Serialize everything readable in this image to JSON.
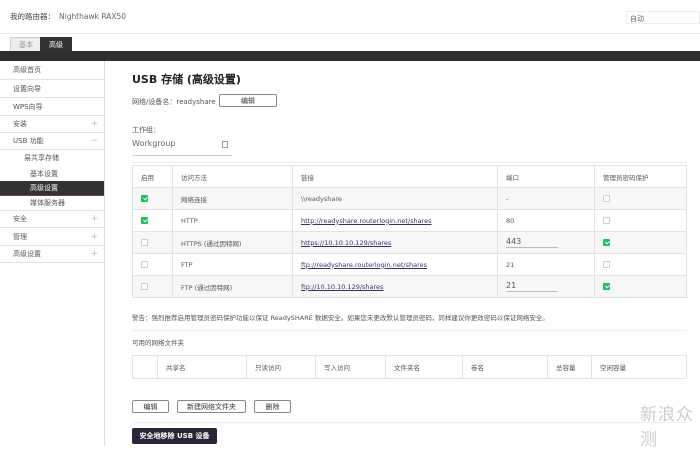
{
  "header": {
    "router_label": "我的路由器：",
    "router_name": "Nighthawk RAX50",
    "language": "自动"
  },
  "tabs": [
    {
      "label": "基本"
    },
    {
      "label": "高级"
    }
  ],
  "sidebar": {
    "items": [
      {
        "label": "高级首页"
      },
      {
        "label": "设置向导"
      },
      {
        "label": "WPS向导"
      },
      {
        "label": "安装",
        "toggle": "+"
      },
      {
        "label": "USB 功能",
        "toggle": "−"
      },
      {
        "label": "易共享存储"
      },
      {
        "label": "基本设置"
      },
      {
        "label": "高级设置"
      },
      {
        "label": "媒体服务器"
      },
      {
        "label": "安全",
        "toggle": "+"
      },
      {
        "label": "管理",
        "toggle": "+"
      },
      {
        "label": "高级设置",
        "toggle": "+"
      }
    ]
  },
  "main": {
    "title": "USB 存储 (高级设置)",
    "device_label": "网络/设备名：",
    "device_name": "readyshare",
    "edit_label": "编辑",
    "workgroup_label": "工作组：",
    "workgroup_value": "Workgroup",
    "protocol_table": {
      "headers": [
        "启用",
        "访问方法",
        "链接",
        "端口",
        "管理员密码保护"
      ],
      "rows": [
        {
          "enabled": true,
          "method": "网络连接",
          "link": "\\\\readyshare",
          "is_link": false,
          "port": "-",
          "port_editable": false,
          "protected": false
        },
        {
          "enabled": true,
          "method": "HTTP",
          "link": "http://readyshare.routerlogin.net/shares",
          "is_link": true,
          "port": "80",
          "port_editable": false,
          "protected": false
        },
        {
          "enabled": false,
          "method": "HTTPS (通过因特网)",
          "link": "https://10.10.10.129/shares",
          "is_link": true,
          "port": "443",
          "port_editable": true,
          "protected": true
        },
        {
          "enabled": false,
          "method": "FTP",
          "link": "ftp://readyshare.routerlogin.net/shares",
          "is_link": true,
          "port": "21",
          "port_editable": false,
          "protected": false
        },
        {
          "enabled": false,
          "method": "FTP (通过因特网)",
          "link": "ftp://10.10.10.129/shares",
          "is_link": true,
          "port": "21",
          "port_editable": true,
          "protected": true
        }
      ]
    },
    "warning": "警告：强烈推荐启用管理员密码保护功能以保证 ReadySHARE 数据安全。如果您未更改默认管理员密码，同样建议你更改密码以保证网络安全。",
    "folders_title": "可用的网络文件夹",
    "folder_headers": [
      "",
      "共享名",
      "只读访问",
      "写入访问",
      "文件夹名",
      "卷名",
      "总容量",
      "空闲容量"
    ],
    "buttons": {
      "edit": "编辑",
      "new_folder": "新建网络文件夹",
      "delete": "删除"
    },
    "remove_usb": "安全地移除 USB 设备"
  },
  "watermark": "新浪众测"
}
